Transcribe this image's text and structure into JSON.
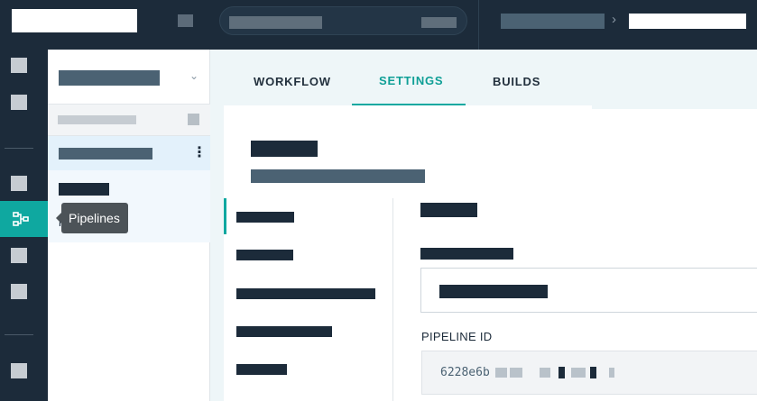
{
  "tooltip": {
    "text": "Pipelines"
  },
  "panel": {
    "sub_item_id": "ili 42"
  },
  "tabs": [
    {
      "label": "WORKFLOW"
    },
    {
      "label": "SETTINGS"
    },
    {
      "label": "BUILDS"
    }
  ],
  "settings": {
    "pipeline_id_label": "PIPELINE ID",
    "pipeline_id_value": "6228e6b"
  },
  "icons": {
    "active_rail": "pipelines-icon",
    "tab_caret": "chevron-down-icon",
    "breadcrumb_separator": "chevron-right-icon",
    "row_menu": "kebab-menu-icon"
  },
  "colors": {
    "topbar": "#1c2b3a",
    "accent": "#0fa8a0",
    "selected_row": "#e3f1fb"
  }
}
